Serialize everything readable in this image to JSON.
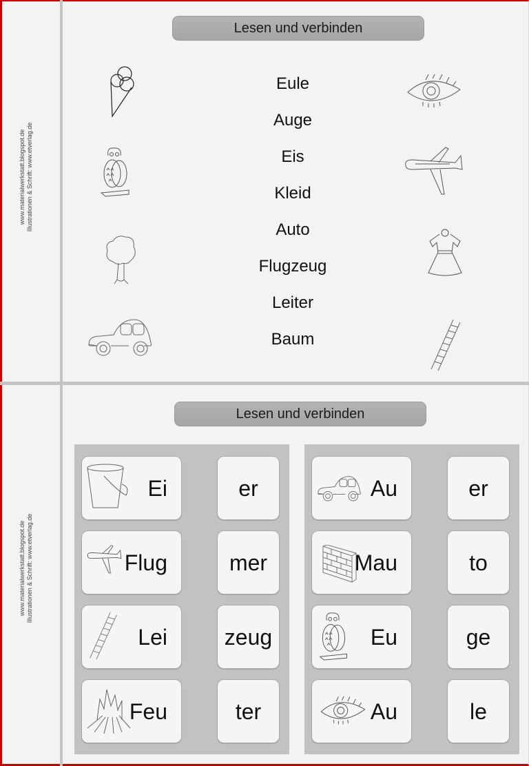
{
  "credits": {
    "line1": "www.materialwerkstatt.blogspot.de",
    "line2": "Illustrationen & Schrift:  www.etverlag.de"
  },
  "section1": {
    "title": "Lesen und verbinden",
    "words": [
      "Eule",
      "Auge",
      "Eis",
      "Kleid",
      "Auto",
      "Flugzeug",
      "Leiter",
      "Baum"
    ],
    "left_pictures": [
      "ice-cream-icon",
      "owl-icon",
      "tree-icon",
      "car-icon"
    ],
    "right_pictures": [
      "eye-icon",
      "airplane-icon",
      "dress-icon",
      "ladder-icon"
    ]
  },
  "section2": {
    "title": "Lesen und verbinden",
    "left_panel": {
      "picture_cards": [
        {
          "icon": "bucket-icon",
          "syllable": "Ei"
        },
        {
          "icon": "airplane-icon",
          "syllable": "Flug"
        },
        {
          "icon": "ladder-icon",
          "syllable": "Lei"
        },
        {
          "icon": "campfire-icon",
          "syllable": "Feu"
        }
      ],
      "ending_cards": [
        "er",
        "mer",
        "zeug",
        "ter"
      ]
    },
    "right_panel": {
      "picture_cards": [
        {
          "icon": "car-icon",
          "syllable": "Au"
        },
        {
          "icon": "brick-wall-icon",
          "syllable": "Mau"
        },
        {
          "icon": "owl-icon",
          "syllable": "Eu"
        },
        {
          "icon": "eye-icon",
          "syllable": "Au"
        }
      ],
      "ending_cards": [
        "er",
        "to",
        "ge",
        "le"
      ]
    }
  }
}
